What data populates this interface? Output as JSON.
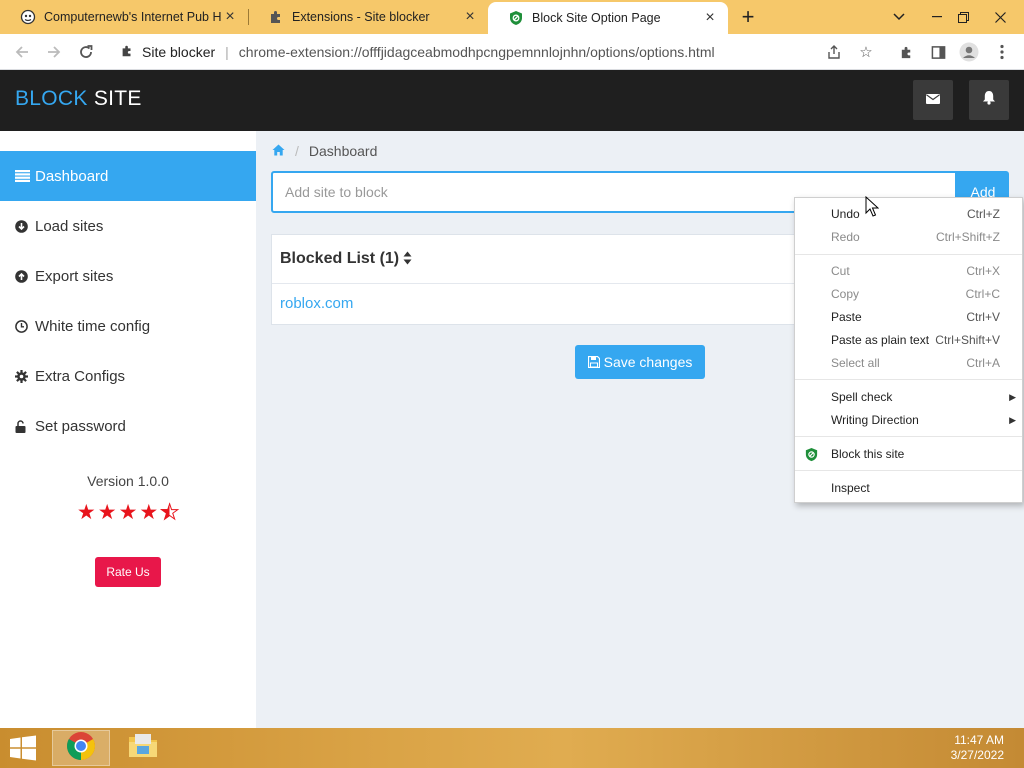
{
  "browser": {
    "tabs": [
      {
        "title": "Computernewb's Internet Pub H..",
        "active": false
      },
      {
        "title": "Extensions - Site blocker",
        "active": false
      },
      {
        "title": "Block Site Option Page",
        "active": true
      }
    ],
    "omnibox": {
      "extension_name": "Site blocker",
      "divider": "|",
      "url": "chrome-extension://offfjidagceabmodhpcngpemnnlojnhn/options/options.html"
    }
  },
  "app": {
    "brand_part1": "BLOCK",
    "brand_part2": "SITE",
    "accent_color": "#35a7f0",
    "sidebar": {
      "items": [
        {
          "label": "Dashboard",
          "icon": "list-icon",
          "active": true
        },
        {
          "label": "Load sites",
          "icon": "download-circle-icon"
        },
        {
          "label": "Export sites",
          "icon": "upload-circle-icon"
        },
        {
          "label": "White time config",
          "icon": "clock-icon"
        },
        {
          "label": "Extra Configs",
          "icon": "gear-icon"
        },
        {
          "label": "Set password",
          "icon": "lock-icon"
        }
      ],
      "version": "Version 1.0.0",
      "rating": 4.5,
      "rate_label": "Rate Us"
    },
    "breadcrumb": {
      "separator": "/",
      "current": "Dashboard"
    },
    "search": {
      "placeholder": "Add site to block",
      "value": "",
      "add_label": "Add"
    },
    "blocked_list": {
      "title": "Blocked List (1)",
      "items": [
        "roblox.com"
      ]
    },
    "save_label": "Save changes"
  },
  "context_menu": {
    "items": [
      {
        "label": "Undo",
        "shortcut": "Ctrl+Z"
      },
      {
        "label": "Redo",
        "shortcut": "Ctrl+Shift+Z"
      },
      {
        "label": "Cut",
        "shortcut": "Ctrl+X"
      },
      {
        "label": "Copy",
        "shortcut": "Ctrl+C"
      },
      {
        "label": "Paste",
        "shortcut": "Ctrl+V"
      },
      {
        "label": "Paste as plain text",
        "shortcut": "Ctrl+Shift+V"
      },
      {
        "label": "Select all",
        "shortcut": "Ctrl+A"
      },
      {
        "label": "Spell check"
      },
      {
        "label": "Writing Direction"
      },
      {
        "label": "Block this site"
      },
      {
        "label": "Inspect"
      }
    ]
  },
  "taskbar": {
    "time": "11:47 AM",
    "date": "3/27/2022"
  }
}
